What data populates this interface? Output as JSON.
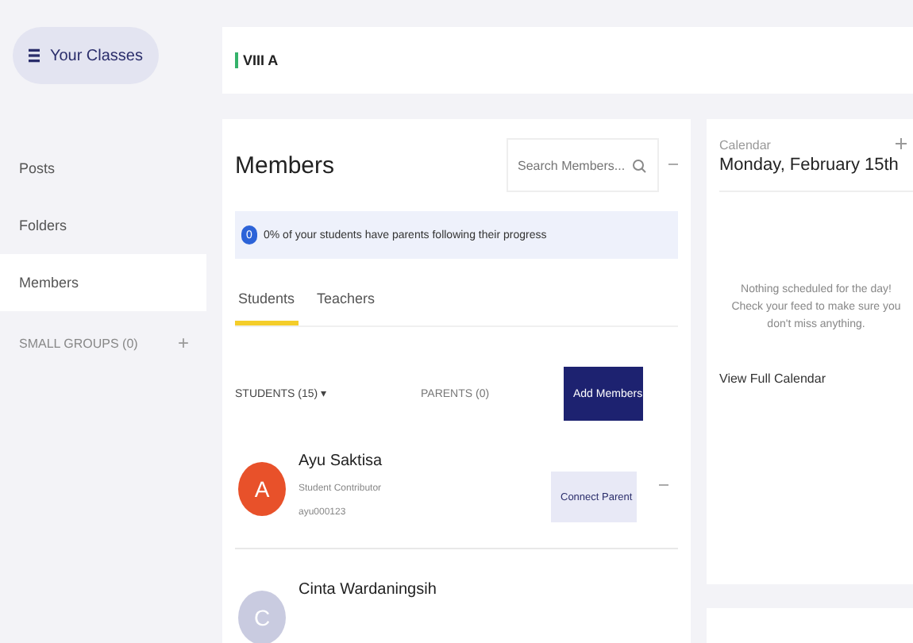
{
  "class_switcher": {
    "label": "Your Classes"
  },
  "top_bar": {
    "class_name": "VIII A"
  },
  "sidebar": {
    "items": [
      {
        "label": "Posts",
        "selected": false
      },
      {
        "label": "Folders",
        "selected": false
      },
      {
        "label": "Members",
        "selected": true
      }
    ],
    "small_groups": {
      "label": "SMALL GROUPS (0)",
      "add": "+"
    }
  },
  "members": {
    "title": "Members",
    "search": {
      "placeholder": "Search Members..."
    },
    "notice": {
      "badge": "0",
      "text": "0% of your students have parents following their progress"
    },
    "tabs": [
      {
        "label": "Students",
        "selected": true
      },
      {
        "label": "Teachers",
        "selected": false
      }
    ],
    "students_filter": "STUDENTS (15) ▾",
    "parents_count": "PARENTS (0)",
    "add_button": "Add Members",
    "rows": [
      {
        "initial": "A",
        "color": "#e8512a",
        "name": "Ayu Saktisa",
        "role": "Student Contributor",
        "username": "ayu000123",
        "action": "Connect Parent"
      },
      {
        "initial": "C",
        "color": "#c9cbe0",
        "name": "Cinta Wardaningsih"
      }
    ]
  },
  "calendar": {
    "label": "Calendar",
    "date": "Monday, February 15th",
    "empty_lines": [
      "Nothing scheduled for the day!",
      "Check your feed to make sure you",
      "don't miss anything."
    ],
    "link": "View Full Calendar"
  }
}
